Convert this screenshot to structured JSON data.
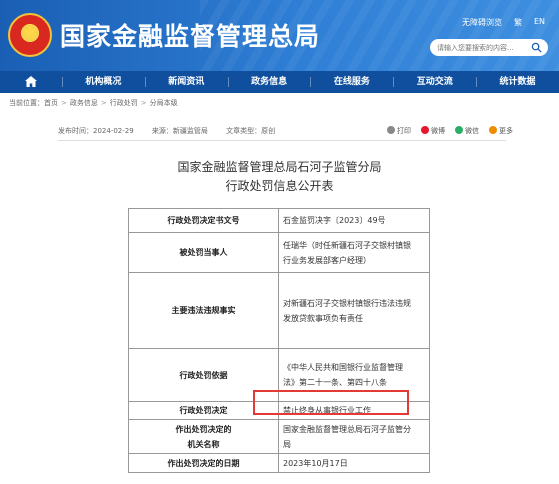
{
  "header": {
    "site_title": "国家金融监督管理总局",
    "top_links": [
      "无障碍浏览",
      "繁",
      "EN"
    ],
    "search_placeholder": "请输入您要搜索的内容..."
  },
  "nav": {
    "items": [
      "机构概况",
      "新闻资讯",
      "政务信息",
      "在线服务",
      "互动交流",
      "统计数据"
    ]
  },
  "breadcrumb": {
    "prefix": "当前位置：",
    "items": [
      "首页",
      "政务信息",
      "行政处罚",
      "分局本级"
    ]
  },
  "meta": {
    "publish_time": "发布时间：2024-02-29",
    "source": "来源：新疆监管局",
    "type": "文章类型：原创"
  },
  "share": {
    "items": [
      {
        "label": "打印",
        "color": "#888888"
      },
      {
        "label": "微博",
        "color": "#e6162d"
      },
      {
        "label": "微信",
        "color": "#2aae67"
      },
      {
        "label": "更多",
        "color": "#f08c00"
      }
    ]
  },
  "document": {
    "title_line1": "国家金融监督管理总局石河子监管分局",
    "title_line2": "行政处罚信息公开表"
  },
  "table": {
    "rows": [
      {
        "key": "行政处罚决定书文号",
        "value": "石金监罚决字〔2023〕49号"
      },
      {
        "key": "被处罚当事人",
        "value_lines": [
          "任瑞华（时任新疆石河子交银村镇银",
          "行业务发展部客户经理）"
        ]
      },
      {
        "key": "主要违法违规事实",
        "value_lines": [
          "对新疆石河子交银村镇银行违法违规",
          "发放贷款事项负有责任"
        ]
      },
      {
        "key": "行政处罚依据",
        "value_lines": [
          "《中华人民共和国银行业监督管理",
          "法》第二十一条、第四十八条"
        ]
      },
      {
        "key": "行政处罚决定",
        "value": "禁止终身从事银行业工作"
      },
      {
        "key_lines": [
          "作出处罚决定的",
          "机关名称"
        ],
        "value_lines": [
          "国家金融监督管理总局石河子监管分",
          "局"
        ]
      },
      {
        "key": "作出处罚决定的日期",
        "value": "2023年10月17日"
      }
    ]
  },
  "colors": {
    "header_blue": "#1a5fb4",
    "nav_blue": "#0f4f9e",
    "highlight_red": "#e53935"
  }
}
